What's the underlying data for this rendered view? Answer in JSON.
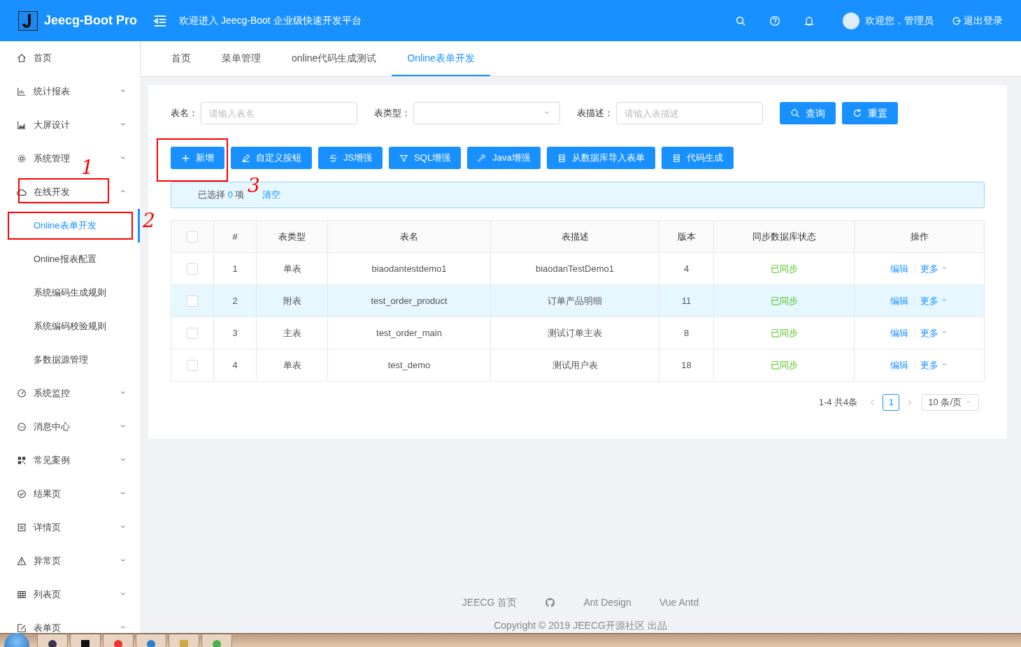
{
  "header": {
    "logo_text": "Jeecg-Boot Pro",
    "welcome": "欢迎进入 Jeecg-Boot 企业级快速开发平台",
    "user": "欢迎您，管理员",
    "logout": "退出登录"
  },
  "sidebar": {
    "items": [
      {
        "label": "首页",
        "expandable": false
      },
      {
        "label": "统计报表",
        "expandable": true,
        "expanded": false
      },
      {
        "label": "大屏设计",
        "expandable": true,
        "expanded": false
      },
      {
        "label": "系统管理",
        "expandable": true,
        "expanded": false
      },
      {
        "label": "在线开发",
        "expandable": true,
        "expanded": true,
        "children": [
          {
            "label": "Online表单开发",
            "selected": true
          },
          {
            "label": "Online报表配置",
            "selected": false
          },
          {
            "label": "系统编码生成规则",
            "selected": false
          },
          {
            "label": "系统编码校验规则",
            "selected": false
          },
          {
            "label": "多数据源管理",
            "selected": false
          }
        ]
      },
      {
        "label": "系统监控",
        "expandable": true,
        "expanded": false
      },
      {
        "label": "消息中心",
        "expandable": true,
        "expanded": false
      },
      {
        "label": "常见案例",
        "expandable": true,
        "expanded": false
      },
      {
        "label": "结果页",
        "expandable": true,
        "expanded": false
      },
      {
        "label": "详情页",
        "expandable": true,
        "expanded": false
      },
      {
        "label": "异常页",
        "expandable": true,
        "expanded": false
      },
      {
        "label": "列表页",
        "expandable": true,
        "expanded": false
      },
      {
        "label": "表单页",
        "expandable": true,
        "expanded": false
      }
    ]
  },
  "tabs": [
    {
      "label": "首页",
      "selected": false
    },
    {
      "label": "菜单管理",
      "selected": false
    },
    {
      "label": "online代码生成测试",
      "selected": false
    },
    {
      "label": "Online表单开发",
      "selected": true
    }
  ],
  "search": {
    "fields": [
      {
        "kind": "input",
        "label": "表名：",
        "placeholder": "请输入表名"
      },
      {
        "kind": "select",
        "label": "表类型："
      },
      {
        "kind": "input",
        "label": "表描述：",
        "placeholder": "请输入表描述"
      }
    ],
    "buttons": [
      "查询",
      "重置"
    ]
  },
  "toolbar": [
    "新增",
    "自定义按钮",
    "JS增强",
    "SQL增强",
    "Java增强",
    "从数据库导入表单",
    "代码生成"
  ],
  "alert": {
    "prefix": "已选择",
    "count": "0",
    "suffix": "项",
    "clear": "清空"
  },
  "table": {
    "header_checked": false,
    "columns": [
      "#",
      "表类型",
      "表名",
      "表描述",
      "版本",
      "同步数据库状态",
      "操作"
    ],
    "rows": [
      {
        "checked": false,
        "hovered": false,
        "cells": [
          "1",
          "单表",
          "biaodantestdemo1",
          "biaodanTestDemo1",
          "4",
          "已同步"
        ],
        "actions": [
          "编辑",
          "更多"
        ]
      },
      {
        "checked": false,
        "hovered": true,
        "cells": [
          "2",
          "附表",
          "test_order_product",
          "订单产品明细",
          "11",
          "已同步"
        ],
        "actions": [
          "编辑",
          "更多"
        ]
      },
      {
        "checked": false,
        "hovered": false,
        "cells": [
          "3",
          "主表",
          "test_order_main",
          "测试订单主表",
          "8",
          "已同步"
        ],
        "actions": [
          "编辑",
          "更多"
        ]
      },
      {
        "checked": false,
        "hovered": false,
        "cells": [
          "4",
          "单表",
          "test_demo",
          "测试用户表",
          "18",
          "已同步"
        ],
        "actions": [
          "编辑",
          "更多"
        ]
      }
    ]
  },
  "pagination": {
    "summary": "1-4 共4条",
    "pages": [
      {
        "label": "1",
        "selected": true
      }
    ],
    "page_size": "10 条/页"
  },
  "footer": {
    "links": [
      "JEECG 首页",
      "Ant Design",
      "Vue Antd"
    ],
    "copyright": "Copyright © 2019 JEECG开源社区 出品"
  },
  "annotations": [
    {
      "label": "1"
    },
    {
      "label": "2"
    },
    {
      "label": "3"
    }
  ]
}
